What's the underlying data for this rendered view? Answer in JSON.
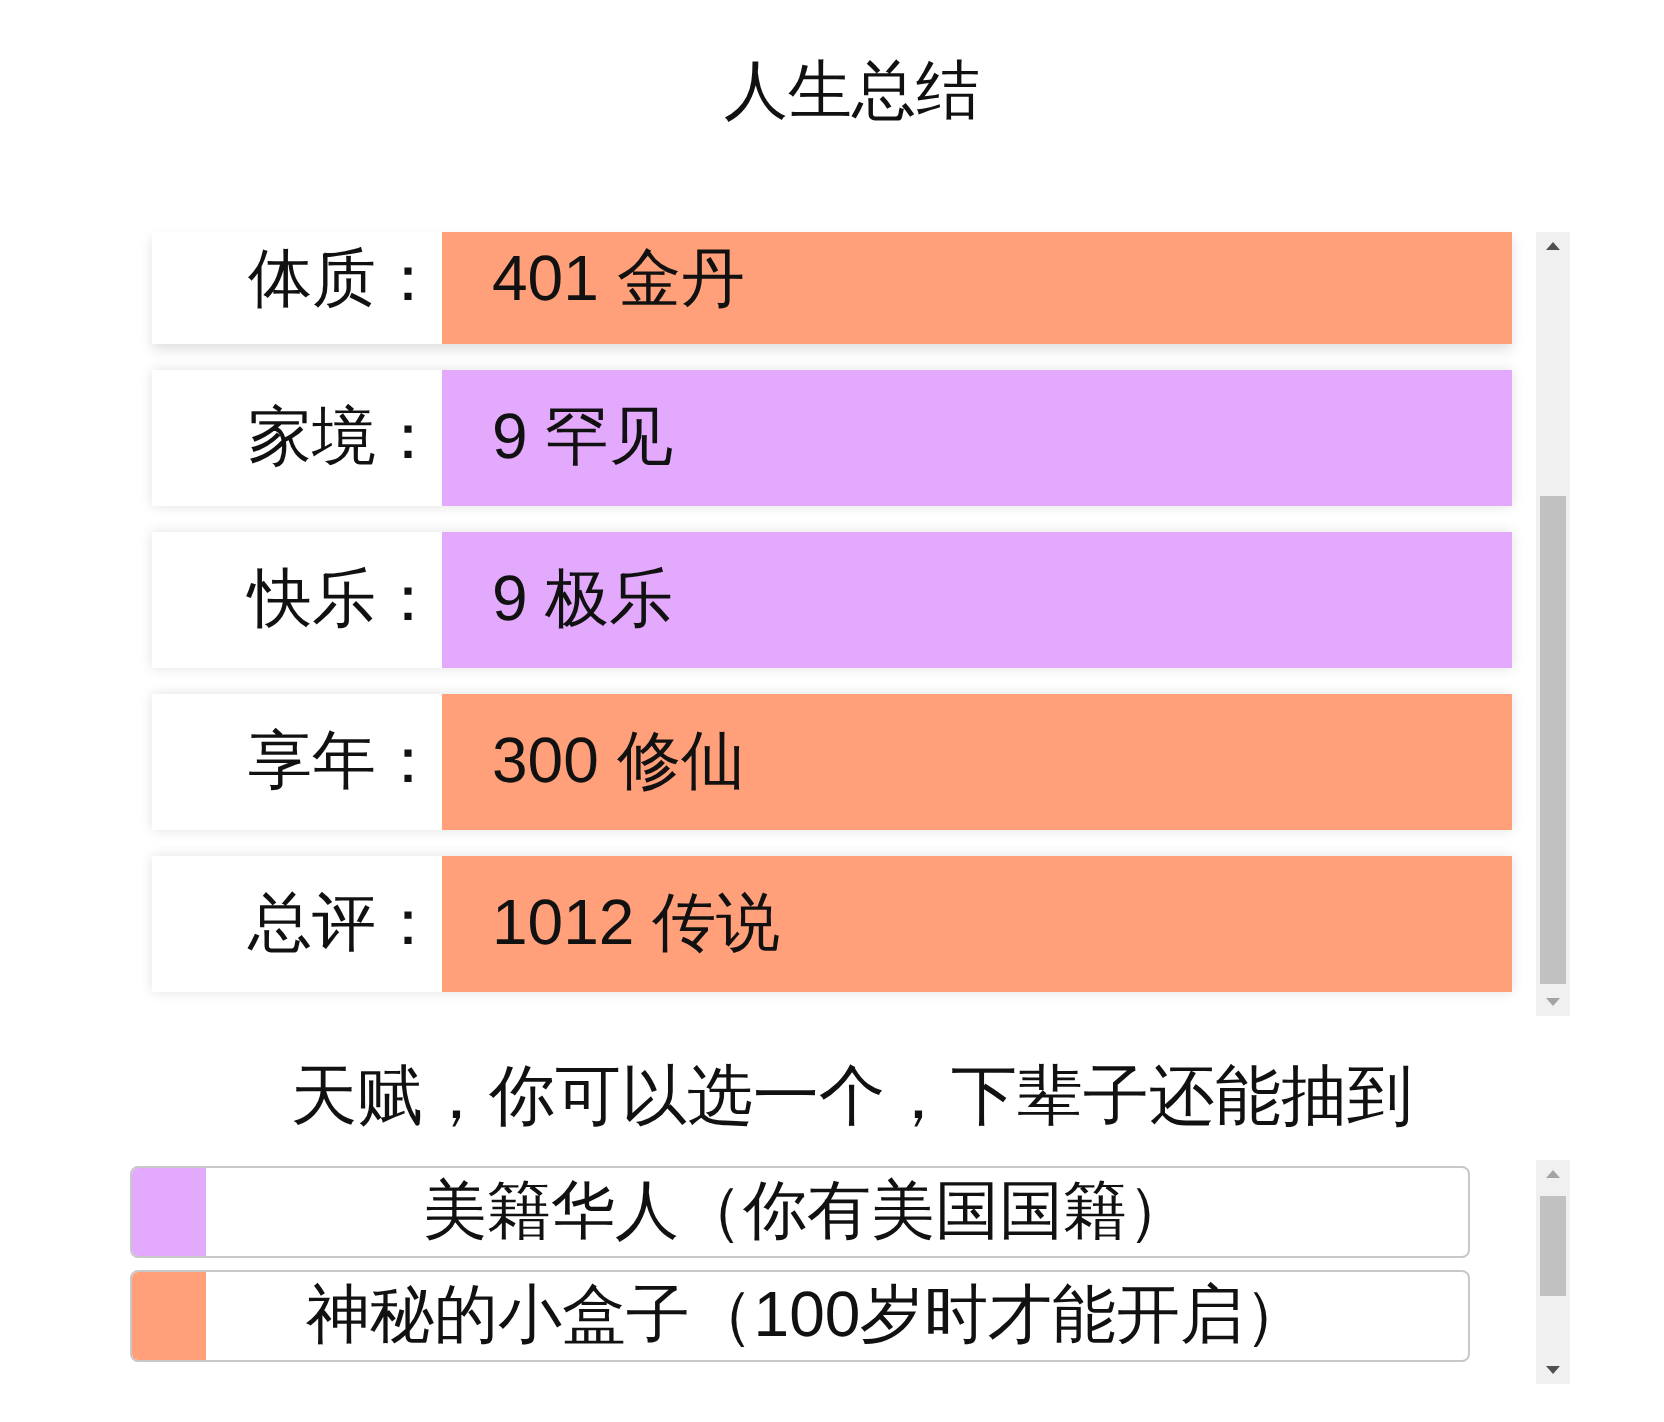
{
  "title": "人生总结",
  "summary": {
    "rows": [
      {
        "label": "体质：",
        "value": "401 金丹",
        "color": "#ffa07a"
      },
      {
        "label": "家境：",
        "value": "9 罕见",
        "color": "#e2a9fd"
      },
      {
        "label": "快乐：",
        "value": "9 极乐",
        "color": "#e2a9fd"
      },
      {
        "label": "享年：",
        "value": "300 修仙",
        "color": "#ffa07a"
      },
      {
        "label": "总评：",
        "value": "1012 传说",
        "color": "#ffa07a"
      }
    ]
  },
  "talents": {
    "heading": "天赋，你可以选一个，下辈子还能抽到",
    "items": [
      {
        "name": "美籍华人（你有美国国籍）",
        "color": "#e2a9fd"
      },
      {
        "name": "神秘的小盒子（100岁时才能开启）",
        "color": "#ffa07a"
      }
    ]
  }
}
